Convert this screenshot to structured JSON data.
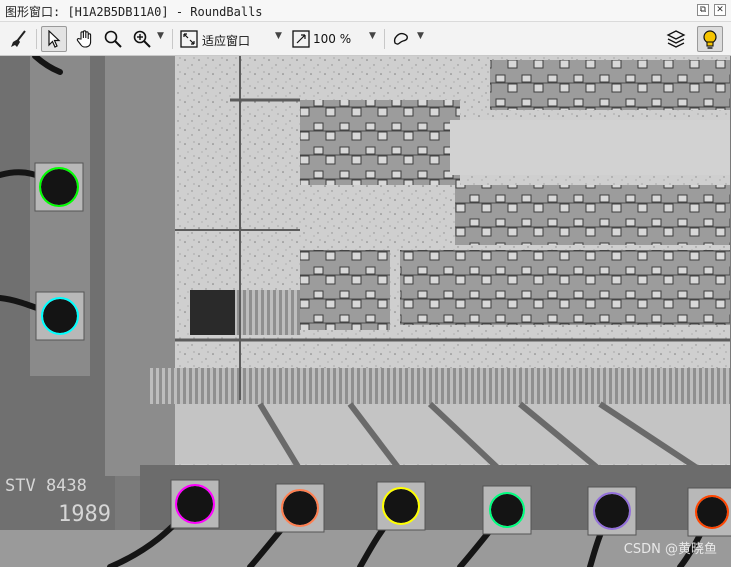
{
  "window": {
    "title": "图形窗口: [H1A2B5DB11A0] - RoundBalls",
    "restore_glyph": "⧉",
    "close_glyph": "✕"
  },
  "toolbar": {
    "zoom_mode_label": "适应窗口",
    "zoom_percent_label": "100 %",
    "icons": [
      "clear-brush-icon",
      "pointer-icon",
      "hand-pan-icon",
      "magnifier-icon",
      "zoom-in-icon",
      "fit-window-icon",
      "zoom-percent-icon",
      "region-shape-icon",
      "layers-icon",
      "bulb-icon"
    ]
  },
  "image": {
    "chip_marking_top": "STV 8438",
    "chip_marking_bottom": "1989",
    "watermark": "CSDN @黄晓鱼",
    "balls": [
      {
        "color": "#00ff00"
      },
      {
        "color": "#00ffff"
      },
      {
        "color": "#ff00ff"
      },
      {
        "color": "#ff7f50"
      },
      {
        "color": "#ffff00"
      },
      {
        "color": "#00ff7f"
      },
      {
        "color": "#9370db"
      },
      {
        "color": "#ff4500"
      }
    ]
  }
}
